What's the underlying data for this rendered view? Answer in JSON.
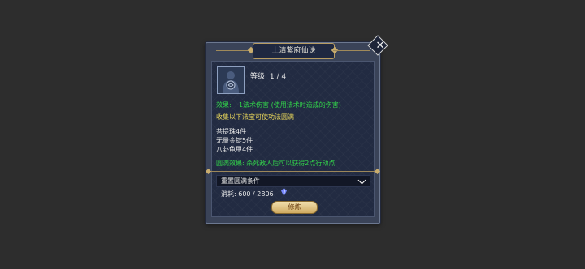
{
  "dialog": {
    "title": "上清紫府仙诀",
    "level_text": "等级: 1 / 4",
    "effect_text": "效果: +1法术伤害 (使用法术时造成的伤害)",
    "collect_text": "收集以下法宝可使功法圆满",
    "items": [
      "菩提珠4件",
      "无量金锭5件",
      "八卦龟甲4件"
    ],
    "complete_effect_text": "圆满效果: 杀死敌人后可以获得2点行动点",
    "dropdown_label": "重置圆满条件",
    "cost_text": "消耗: 600 / 2806",
    "train_button": "修炼"
  },
  "icons": {
    "close": "close-icon",
    "portrait": "character-portrait-icon",
    "dropdown": "chevron-down-icon",
    "currency": "crystal-icon"
  },
  "colors": {
    "green_text": "#32d54a",
    "yellow_text": "#e8d65a",
    "panel_bg": "#222b42",
    "gold_accent": "#c9ad6e"
  }
}
